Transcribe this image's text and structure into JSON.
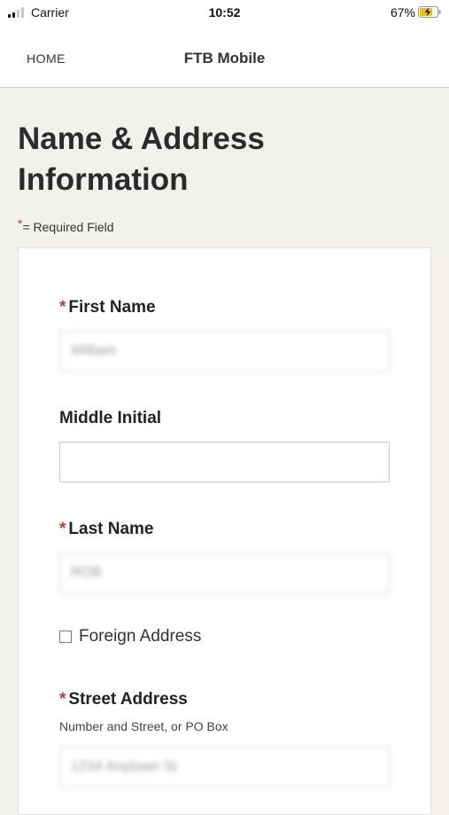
{
  "status_bar": {
    "carrier": "Carrier",
    "time": "10:52",
    "battery": "67%",
    "signal_bars_active": 2,
    "signal_bars_total": 4
  },
  "nav": {
    "home_label": "HOME",
    "title": "FTB Mobile"
  },
  "page": {
    "title": "Name & Address Information",
    "required_marker": "*",
    "required_note": "= Required Field"
  },
  "form": {
    "first_name": {
      "label": "First Name",
      "required": true,
      "value": "William"
    },
    "middle_initial": {
      "label": "Middle Initial",
      "required": false,
      "value": ""
    },
    "last_name": {
      "label": "Last Name",
      "required": true,
      "value": "ROB"
    },
    "foreign_address": {
      "label": "Foreign Address",
      "checked": false
    },
    "street_address": {
      "label": "Street Address",
      "required": true,
      "hint": "Number and Street, or PO Box",
      "value": "1234 Anytown St"
    }
  },
  "colors": {
    "required_star": "#c0392b",
    "page_background": "#f2f1ee",
    "battery_charging": "#f5c400"
  }
}
